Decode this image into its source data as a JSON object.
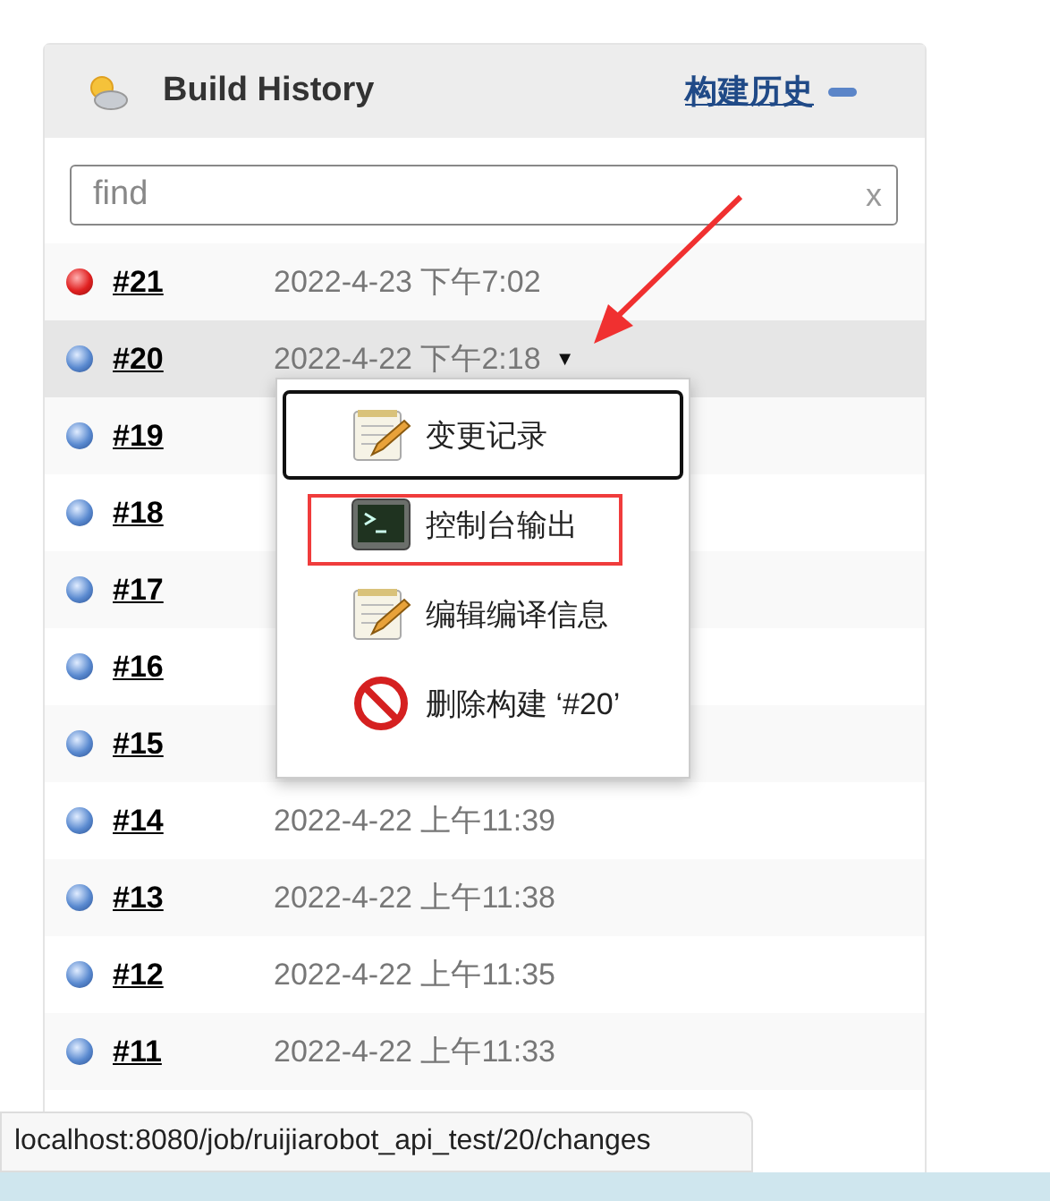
{
  "panel": {
    "title": "Build History",
    "trend_link": "构建历史"
  },
  "search": {
    "placeholder": "find",
    "clear": "x"
  },
  "builds": [
    {
      "number": "#21",
      "date": "2022-4-23 下午7:02",
      "kind": "failed",
      "selected": false
    },
    {
      "number": "#20",
      "date": "2022-4-22 下午2:18",
      "kind": "success",
      "selected": true,
      "menu_caret": "▼"
    },
    {
      "number": "#19",
      "kind": "success",
      "selected": false
    },
    {
      "number": "#18",
      "kind": "success",
      "selected": false
    },
    {
      "number": "#17",
      "kind": "success",
      "selected": false
    },
    {
      "number": "#16",
      "kind": "success",
      "selected": false
    },
    {
      "number": "#15",
      "kind": "success",
      "selected": false
    },
    {
      "number": "#14",
      "date": "2022-4-22 上午11:39",
      "kind": "success",
      "selected": false
    },
    {
      "number": "#13",
      "date": "2022-4-22 上午11:38",
      "kind": "success",
      "selected": false
    },
    {
      "number": "#12",
      "date": "2022-4-22 上午11:35",
      "kind": "success",
      "selected": false
    },
    {
      "number": "#11",
      "date": "2022-4-22 上午11:33",
      "kind": "success",
      "selected": false
    }
  ],
  "context_menu": [
    {
      "label": "变更记录",
      "kind": "notepad",
      "focused": true,
      "annotated": false
    },
    {
      "label": "控制台输出",
      "kind": "terminal",
      "focused": false,
      "annotated": true
    },
    {
      "label": "编辑编译信息",
      "kind": "notepad",
      "focused": false,
      "annotated": false
    },
    {
      "label": "删除构建 ‘#20’",
      "kind": "delete",
      "focused": false,
      "annotated": false
    }
  ],
  "status_bar": {
    "url": "localhost:8080/job/ruijiarobot_api_test/20/changes"
  }
}
